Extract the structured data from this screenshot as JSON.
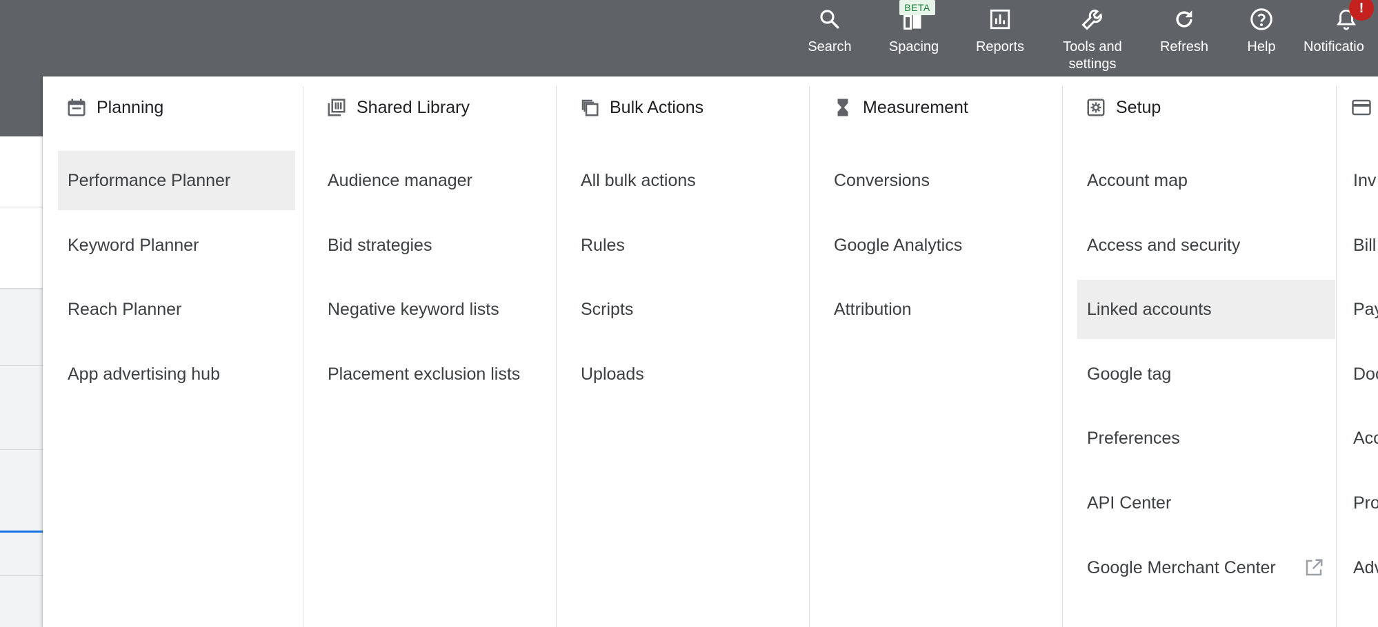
{
  "topbar": {
    "items": [
      {
        "label": "Search",
        "icon": "search-icon"
      },
      {
        "label": "Spacing",
        "icon": "spacing-icon"
      },
      {
        "label": "Reports",
        "icon": "bar-chart-icon"
      },
      {
        "label": "Tools and settings",
        "icon": "wrench-icon"
      },
      {
        "label": "Refresh",
        "icon": "refresh-icon"
      },
      {
        "label": "Help",
        "icon": "help-icon"
      },
      {
        "label": "Notificatio",
        "icon": "bell-icon"
      }
    ],
    "beta_label": "BETA",
    "notification_badge": "!"
  },
  "menu": {
    "columns": [
      {
        "title": "Planning",
        "icon": "calendar-icon",
        "items": [
          "Performance Planner",
          "Keyword Planner",
          "Reach Planner",
          "App advertising hub"
        ]
      },
      {
        "title": "Shared Library",
        "icon": "library-icon",
        "items": [
          "Audience manager",
          "Bid strategies",
          "Negative keyword lists",
          "Placement exclusion lists"
        ]
      },
      {
        "title": "Bulk Actions",
        "icon": "copy-icon",
        "items": [
          "All bulk actions",
          "Rules",
          "Scripts",
          "Uploads"
        ]
      },
      {
        "title": "Measurement",
        "icon": "hourglass-icon",
        "items": [
          "Conversions",
          "Google Analytics",
          "Attribution"
        ]
      },
      {
        "title": "Setup",
        "icon": "gear-icon",
        "items": [
          "Account map",
          "Access and security",
          "Linked accounts",
          "Google tag",
          "Preferences",
          "API Center",
          "Google Merchant Center"
        ]
      },
      {
        "title": "",
        "icon": "credit-card-icon",
        "items": [
          "Inv",
          "Bill",
          "Pay",
          "Doc",
          "Acc",
          "Pro",
          "Adv"
        ]
      }
    ],
    "highlighted": [
      "Performance Planner",
      "Linked accounts"
    ],
    "external_link_item": "Google Merchant Center"
  }
}
